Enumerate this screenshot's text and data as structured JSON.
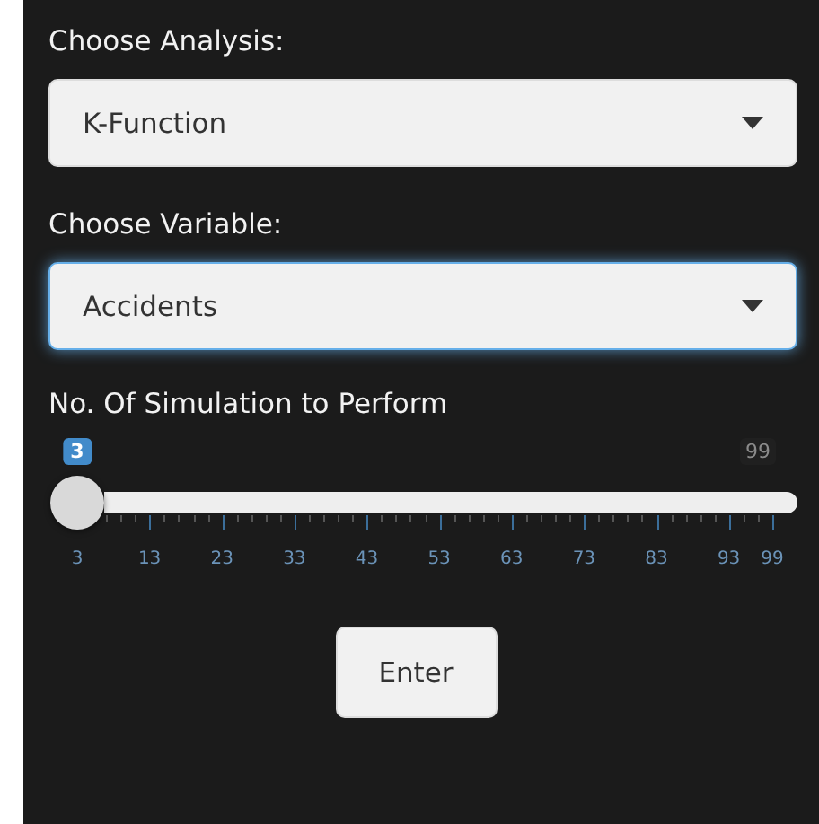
{
  "fields": [
    {
      "label": "Choose Analysis:",
      "value": "K-Function",
      "focused": false
    },
    {
      "label": "Choose Variable:",
      "value": "Accidents",
      "focused": true
    }
  ],
  "slider": {
    "label": "No. Of Simulation to Perform",
    "value_badge": "3",
    "max_badge": "99",
    "level": 0,
    "tick_labels": [
      "3",
      "13",
      "23",
      "33",
      "43",
      "53",
      "63",
      "73",
      "83",
      "93",
      "99"
    ]
  },
  "button": "Enter"
}
